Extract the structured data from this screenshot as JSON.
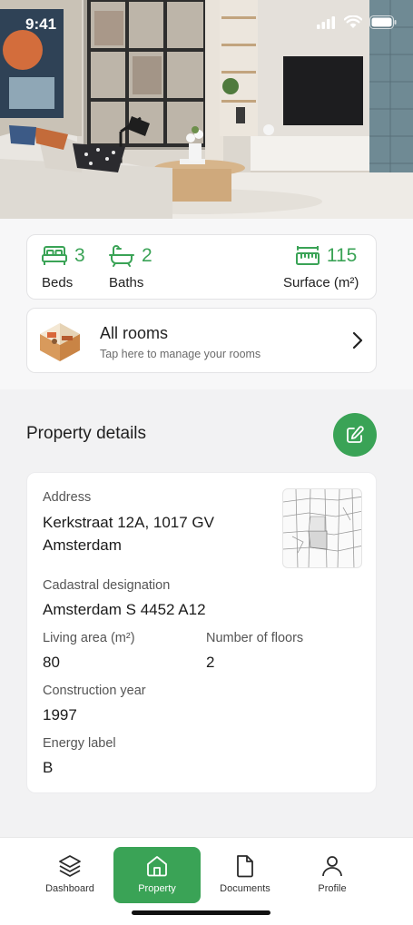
{
  "status_bar": {
    "time": "9:41"
  },
  "hero": {
    "image": "living-room-photo"
  },
  "stats": {
    "beds": {
      "value": "3",
      "label": "Beds",
      "icon": "bed-icon"
    },
    "baths": {
      "value": "2",
      "label": "Baths",
      "icon": "bathtub-icon"
    },
    "surface": {
      "value": "115",
      "label": "Surface (m²)",
      "icon": "ruler-icon"
    }
  },
  "rooms": {
    "title": "All rooms",
    "subtitle": "Tap here to manage your rooms"
  },
  "property_details": {
    "title": "Property details",
    "address_label": "Address",
    "address_line1": "Kerkstraat 12A, 1017 GV",
    "address_line2": "Amsterdam",
    "cadastral_label": "Cadastral designation",
    "cadastral_value": "Amsterdam S 4452 A12",
    "living_area_label": "Living area (m²)",
    "living_area_value": "80",
    "floors_label": "Number of floors",
    "floors_value": "2",
    "construction_label": "Construction year",
    "construction_value": "1997",
    "energy_label": "Energy label",
    "energy_value": "B"
  },
  "nav": {
    "items": [
      {
        "label": "Dashboard",
        "icon": "layers-icon"
      },
      {
        "label": "Property",
        "icon": "home-icon",
        "active": true
      },
      {
        "label": "Documents",
        "icon": "document-icon"
      },
      {
        "label": "Profile",
        "icon": "user-icon"
      }
    ]
  },
  "colors": {
    "accent": "#3aa356",
    "background": "#f2f2f3",
    "card": "#ffffff"
  }
}
